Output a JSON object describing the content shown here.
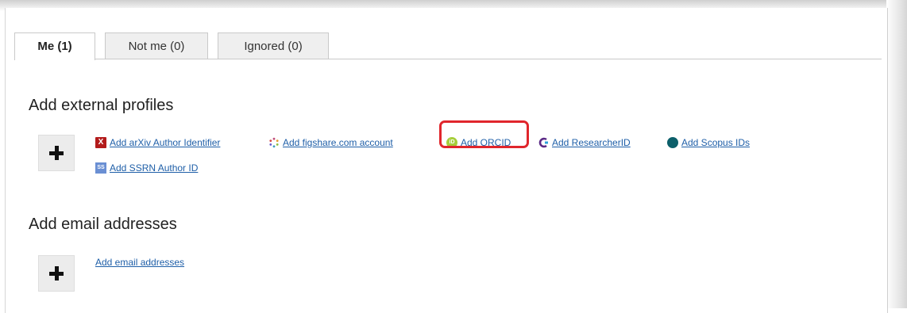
{
  "tabs": [
    {
      "label": "Me (1)",
      "active": true
    },
    {
      "label": "Not me (0)",
      "active": false
    },
    {
      "label": "Ignored (0)",
      "active": false
    }
  ],
  "profiles_section": {
    "heading": "Add external profiles",
    "links": [
      {
        "label": "Add arXiv Author Identifier",
        "icon": "arxiv-icon"
      },
      {
        "label": "Add figshare.com account",
        "icon": "figshare-icon"
      },
      {
        "label": "Add ORCID",
        "icon": "orcid-icon",
        "highlighted": true
      },
      {
        "label": "Add ResearcherID",
        "icon": "researcherid-icon"
      },
      {
        "label": "Add Scopus IDs",
        "icon": "scopus-icon"
      },
      {
        "label": "Add SSRN Author ID",
        "icon": "ssrn-icon"
      }
    ]
  },
  "email_section": {
    "heading": "Add email addresses",
    "link": "Add email addresses"
  },
  "colors": {
    "link": "#1f5fa8",
    "highlight": "#e0262c",
    "arxiv": "#b31b1b",
    "orcid": "#a6ce39",
    "scopus": "#0c5f6a"
  }
}
